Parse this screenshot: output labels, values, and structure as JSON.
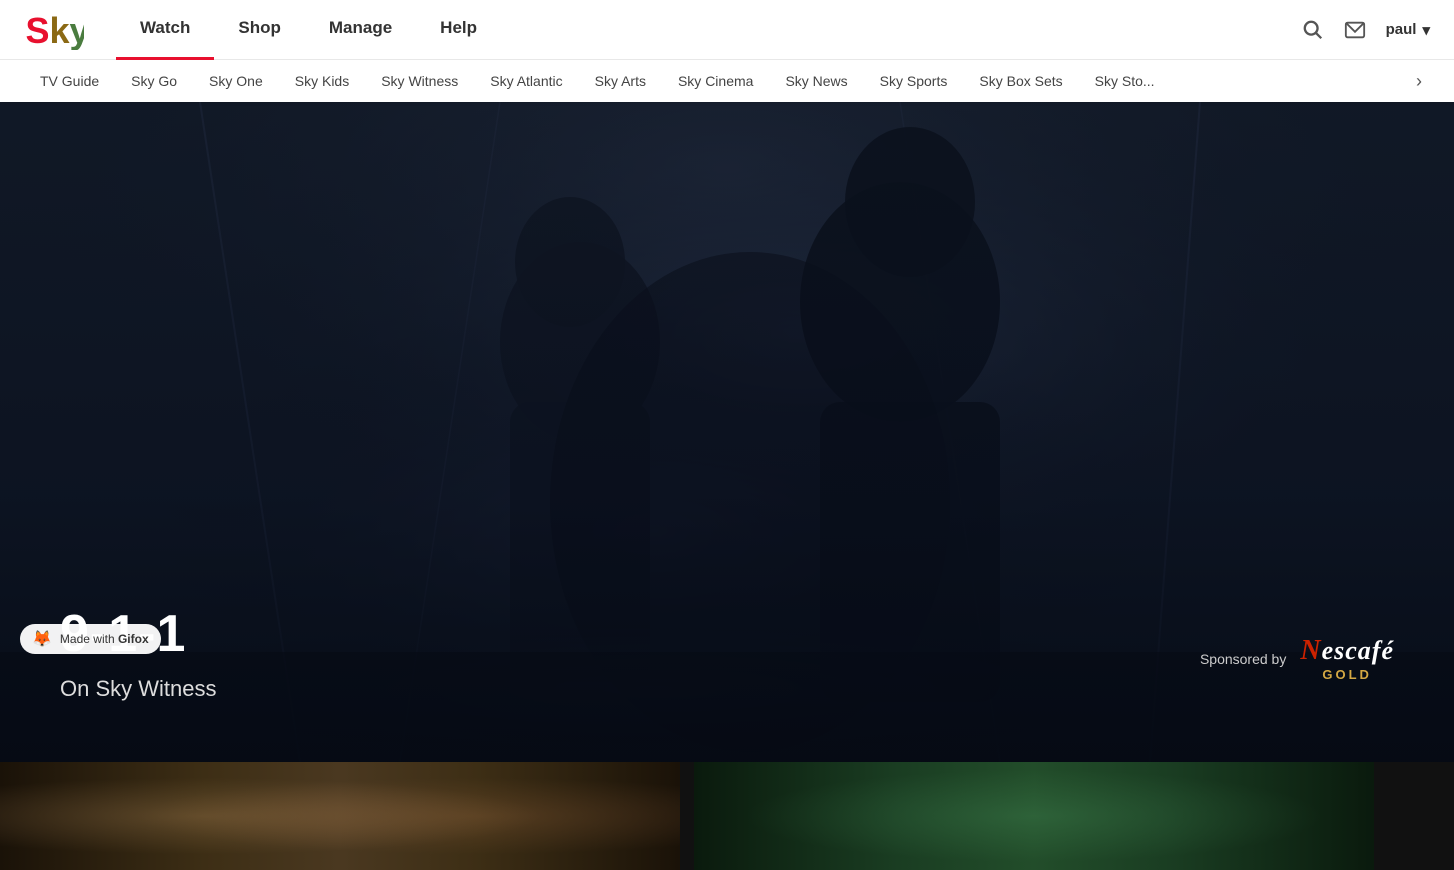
{
  "logo": {
    "alt": "Sky",
    "colors": {
      "s": "#e8102e",
      "k": "#8b6914",
      "y": "#4a7c3f"
    }
  },
  "header": {
    "main_nav": [
      {
        "id": "watch",
        "label": "Watch",
        "active": true
      },
      {
        "id": "shop",
        "label": "Shop",
        "active": false
      },
      {
        "id": "manage",
        "label": "Manage",
        "active": false
      },
      {
        "id": "help",
        "label": "Help",
        "active": false
      }
    ],
    "actions": {
      "search_label": "Search",
      "mail_label": "Messages",
      "user_label": "paul"
    },
    "sub_nav": [
      {
        "id": "tv-guide",
        "label": "TV Guide"
      },
      {
        "id": "sky-go",
        "label": "Sky Go"
      },
      {
        "id": "sky-one",
        "label": "Sky One"
      },
      {
        "id": "sky-kids",
        "label": "Sky Kids"
      },
      {
        "id": "sky-witness",
        "label": "Sky Witness"
      },
      {
        "id": "sky-atlantic",
        "label": "Sky Atlantic"
      },
      {
        "id": "sky-arts",
        "label": "Sky Arts"
      },
      {
        "id": "sky-cinema",
        "label": "Sky Cinema"
      },
      {
        "id": "sky-news",
        "label": "Sky News"
      },
      {
        "id": "sky-sports",
        "label": "Sky Sports"
      },
      {
        "id": "sky-box-sets",
        "label": "Sky Box Sets"
      },
      {
        "id": "sky-store",
        "label": "Sky Sto..."
      }
    ],
    "sub_nav_arrow": "›"
  },
  "hero": {
    "show_title": "9-1-1",
    "show_channel": "On Sky Witness",
    "sponsor_label": "Sponsored by",
    "sponsor_name": "NESCAFÉ",
    "sponsor_sub": "GOLD"
  },
  "gifox": {
    "label": "Made with",
    "brand": "Gifox"
  },
  "thumbnails": [
    {
      "id": "thumb-1",
      "bg": "warm"
    },
    {
      "id": "thumb-2",
      "bg": "green"
    }
  ]
}
